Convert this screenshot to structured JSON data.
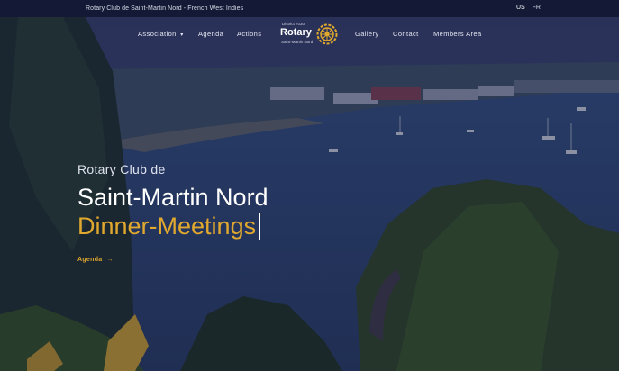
{
  "topbar": {
    "tagline": "Rotary Club de Saint-Martin Nord - French West Indies",
    "languages": [
      "US",
      "FR"
    ]
  },
  "nav": {
    "association": "Association",
    "agenda": "Agenda",
    "actions": "Actions",
    "gallery": "Gallery",
    "contact": "Contact",
    "members": "Members Area"
  },
  "logo": {
    "district": "District 7030",
    "brand": "Rotary",
    "sub": "Saint-Martin Nord"
  },
  "hero": {
    "pretitle": "Rotary Club de",
    "title": "Saint-Martin Nord",
    "typed": "Dinner-Meetings",
    "cta": "Agenda"
  },
  "colors": {
    "accent": "#e0a82e",
    "topbar": "#141a36",
    "overlay": "#1b2244"
  },
  "icons": {
    "dropdown": "chevron-down-icon",
    "cta": "arrow-right-icon",
    "logo": "rotary-wheel-icon"
  }
}
